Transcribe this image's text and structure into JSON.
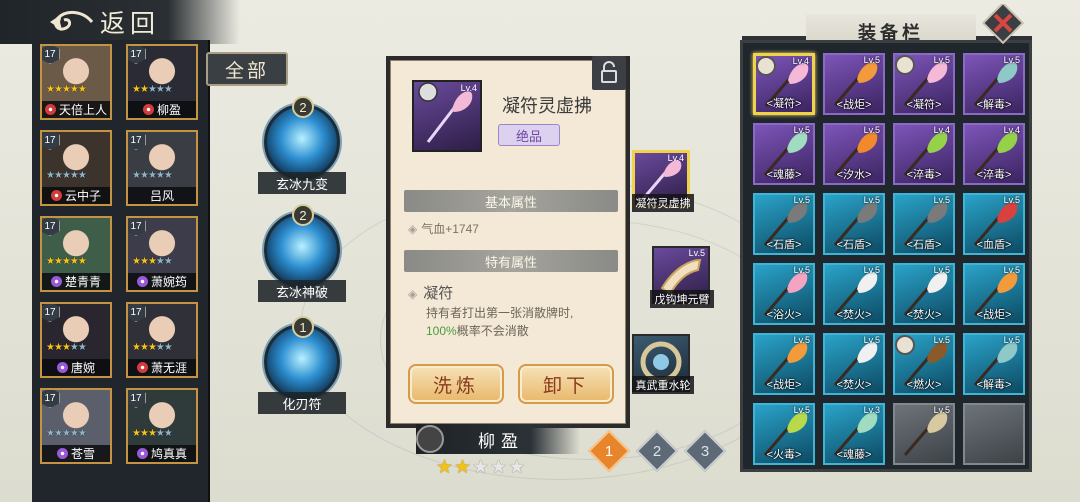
{
  "header": {
    "back_label": "返回"
  },
  "filter": {
    "all_label": "全部"
  },
  "characters": [
    {
      "level": "17",
      "name": "天倍上人",
      "stars": 5,
      "type": "red"
    },
    {
      "level": "17",
      "name": "柳盈",
      "stars": 2,
      "type": "red"
    },
    {
      "level": "17",
      "name": "云中子",
      "stars": 0,
      "type": "red"
    },
    {
      "level": "17",
      "name": "吕风",
      "stars": 0,
      "type": "none"
    },
    {
      "level": "17",
      "name": "楚青青",
      "stars": 5,
      "type": "purple"
    },
    {
      "level": "17",
      "name": "萧婉筠",
      "stars": 3,
      "type": "purple"
    },
    {
      "level": "17",
      "name": "唐婉",
      "stars": 3,
      "type": "purple"
    },
    {
      "level": "17",
      "name": "萧无涯",
      "stars": 3,
      "type": "red"
    },
    {
      "level": "17",
      "name": "苍雪",
      "stars": 0,
      "type": "purple"
    },
    {
      "level": "17",
      "name": "鸠真真",
      "stars": 3,
      "type": "purple"
    }
  ],
  "skills": [
    {
      "count": "2",
      "name": "玄冰九变"
    },
    {
      "count": "2",
      "name": "玄冰神破"
    },
    {
      "count": "1",
      "name": "化刃符"
    }
  ],
  "detail": {
    "level": "Lv.4",
    "name": "凝符灵虚拂",
    "grade": "绝品",
    "basic_header": "基本属性",
    "basic_stat": "气血+1747",
    "unique_header": "特有属性",
    "unique_name": "凝符",
    "unique_desc_a": "持有者打出第一张消散牌时,",
    "unique_pct": "100%",
    "unique_desc_b": "概率不会消散",
    "refine_label": "洗炼",
    "unequip_label": "卸下"
  },
  "equipped": [
    {
      "level": "Lv.4",
      "name": "凝符灵虚拂"
    },
    {
      "level": "Lv.5",
      "name": "戊钩坤元臂"
    },
    {
      "level": "",
      "name": "真武重水轮"
    }
  ],
  "character": {
    "name": "柳盈",
    "stars": 2,
    "max_stars": 5
  },
  "pages": [
    "1",
    "2",
    "3"
  ],
  "bag": {
    "title": "装备栏",
    "items": [
      {
        "level": "Lv.4",
        "name": "<凝符>",
        "rarity": "purple",
        "owned": true,
        "selected": true
      },
      {
        "level": "Lv.5",
        "name": "<战炬>",
        "rarity": "purple",
        "owned": false
      },
      {
        "level": "Lv.5",
        "name": "<凝符>",
        "rarity": "purple",
        "owned": true
      },
      {
        "level": "Lv.5",
        "name": "<解毒>",
        "rarity": "purple",
        "owned": false
      },
      {
        "level": "Lv.5",
        "name": "<魂藤>",
        "rarity": "purple",
        "owned": false
      },
      {
        "level": "Lv.5",
        "name": "<汐水>",
        "rarity": "purple",
        "owned": false
      },
      {
        "level": "Lv.4",
        "name": "<淬毒>",
        "rarity": "purple",
        "owned": false
      },
      {
        "level": "Lv.4",
        "name": "<淬毒>",
        "rarity": "purple",
        "owned": false
      },
      {
        "level": "Lv.5",
        "name": "<石盾>",
        "rarity": "blue",
        "owned": false
      },
      {
        "level": "Lv.5",
        "name": "<石盾>",
        "rarity": "blue",
        "owned": false
      },
      {
        "level": "Lv.5",
        "name": "<石盾>",
        "rarity": "blue",
        "owned": false
      },
      {
        "level": "Lv.5",
        "name": "<血盾>",
        "rarity": "blue",
        "owned": false
      },
      {
        "level": "Lv.5",
        "name": "<浴火>",
        "rarity": "blue",
        "owned": false
      },
      {
        "level": "Lv.5",
        "name": "<焚火>",
        "rarity": "blue",
        "owned": false
      },
      {
        "level": "Lv.5",
        "name": "<焚火>",
        "rarity": "blue",
        "owned": false
      },
      {
        "level": "Lv.5",
        "name": "<战炬>",
        "rarity": "blue",
        "owned": false
      },
      {
        "level": "Lv.5",
        "name": "<战炬>",
        "rarity": "blue",
        "owned": false
      },
      {
        "level": "Lv.5",
        "name": "<焚火>",
        "rarity": "blue",
        "owned": false
      },
      {
        "level": "Lv.5",
        "name": "<燃火>",
        "rarity": "blue",
        "owned": true
      },
      {
        "level": "Lv.5",
        "name": "<解毒>",
        "rarity": "blue",
        "owned": false
      },
      {
        "level": "Lv.5",
        "name": "<火毒>",
        "rarity": "blue",
        "owned": false
      },
      {
        "level": "Lv.3",
        "name": "<魂藤>",
        "rarity": "blue",
        "owned": false
      },
      {
        "level": "Lv.5",
        "name": "",
        "rarity": "gray",
        "owned": false
      },
      {
        "level": "",
        "name": "",
        "rarity": "empty",
        "owned": false
      }
    ]
  },
  "colors": {
    "gold": "#c49443",
    "purple_slot": "#7d55b9",
    "blue_slot": "#2aa3c9",
    "highlight": "#f1d34b",
    "button": "#e8b86a"
  }
}
